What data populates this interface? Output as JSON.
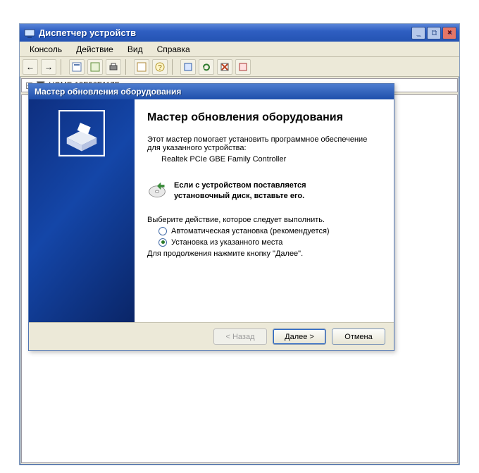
{
  "dm": {
    "title": "Диспетчер устройств",
    "menu": [
      "Консоль",
      "Действие",
      "Вид",
      "Справка"
    ],
    "computer_node": "HOME-12E56E117F",
    "win_buttons": {
      "min": "_",
      "max": "□",
      "close": "×"
    }
  },
  "wizard": {
    "title": "Мастер обновления оборудования",
    "heading": "Мастер обновления оборудования",
    "intro": "Этот мастер помогает установить программное обеспечение для указанного устройства:",
    "device": "Realtek PCIe GBE Family Controller",
    "cd_hint_l1": "Если с устройством поставляется",
    "cd_hint_l2": "установочный диск, вставьте его.",
    "choose_action": "Выберите действие, которое следует выполнить.",
    "opt_auto": "Автоматическая установка (рекомендуется)",
    "opt_manual": "Установка из указанного места",
    "selected_option": "manual",
    "continue_note": "Для продолжения нажмите кнопку \"Далее\".",
    "buttons": {
      "back": "< Назад",
      "next": "Далее >",
      "cancel": "Отмена"
    }
  }
}
